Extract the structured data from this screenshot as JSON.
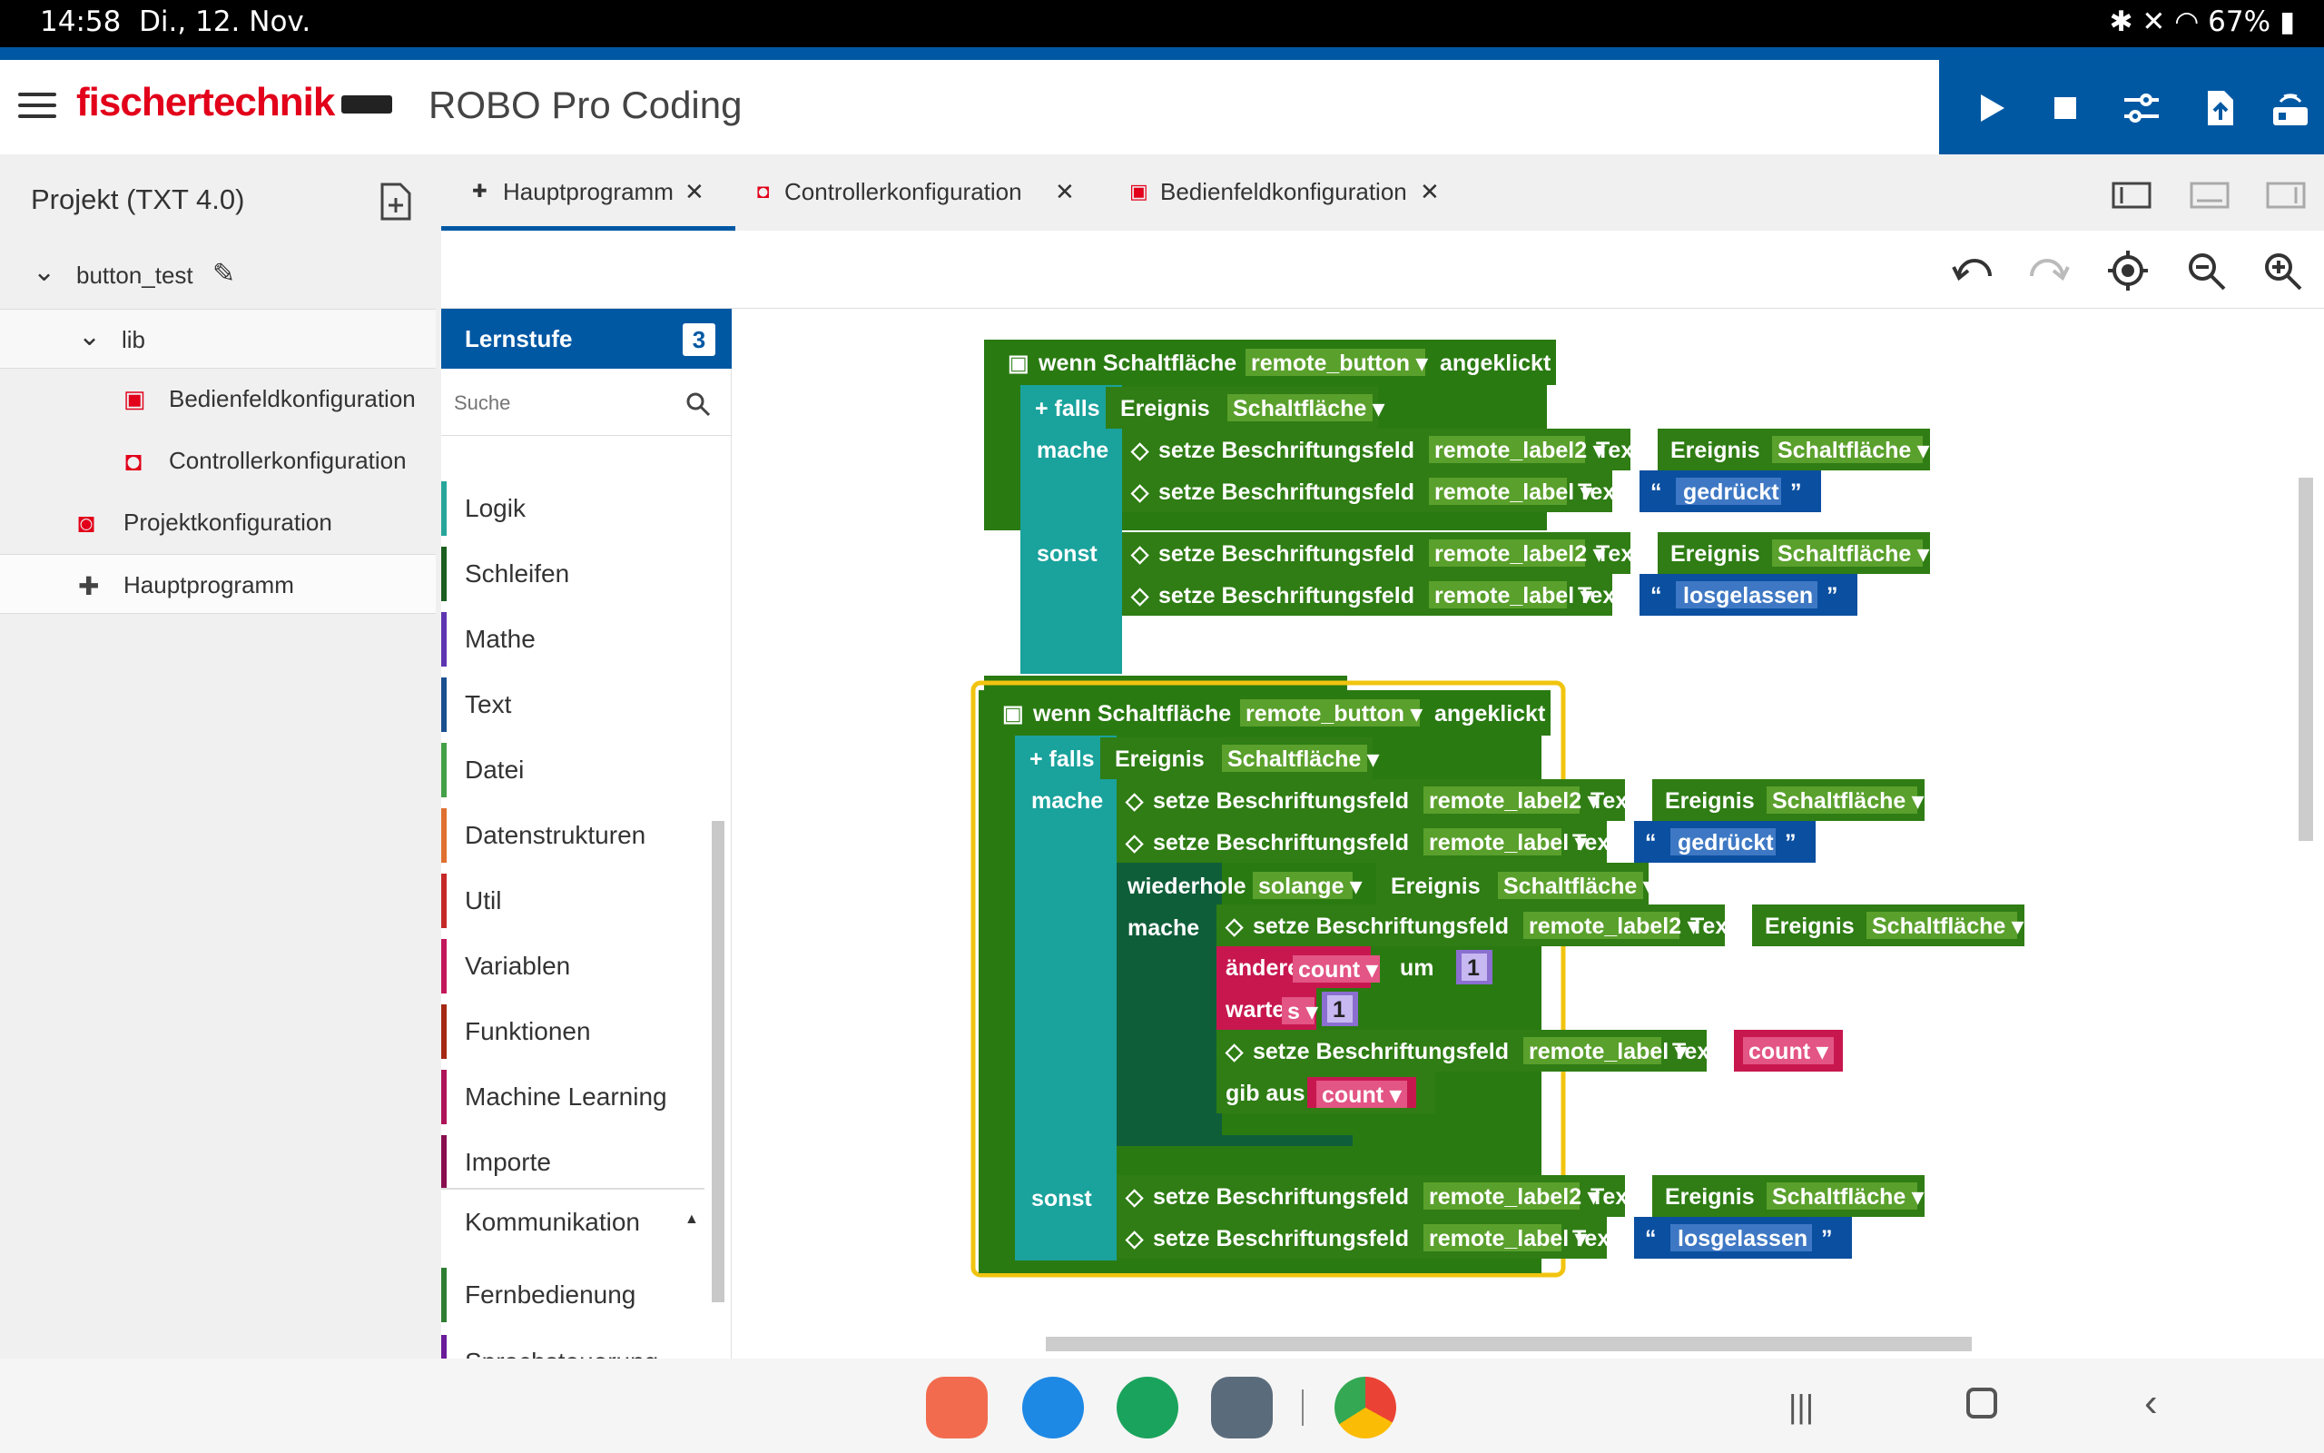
{
  "statusbar": {
    "time": "14:58",
    "date": "Di., 12. Nov.",
    "battery": "67%"
  },
  "header": {
    "logo_a": "fischer",
    "logo_b": "technik",
    "title": "ROBO Pro Coding"
  },
  "toolbar": {
    "icons": [
      "play-icon",
      "stop-icon",
      "settings-sliders-icon",
      "upload-icon",
      "controller-icon"
    ]
  },
  "sidebar": {
    "project_title": "Projekt (TXT 4.0)",
    "tree": [
      {
        "label": "button_test",
        "icon": "chevron-down-icon"
      },
      {
        "label": "lib",
        "icon": "chevron-down-icon"
      },
      {
        "label": "Bedienfeldkonfiguration",
        "icon": "remote-icon"
      },
      {
        "label": "Controllerkonfiguration",
        "icon": "controller-config-icon"
      },
      {
        "label": "Projektkonfiguration",
        "icon": "project-config-icon"
      },
      {
        "label": "Hauptprogramm",
        "icon": "puzzle-icon"
      }
    ]
  },
  "tabs": [
    {
      "label": "Hauptprogramm",
      "active": true
    },
    {
      "label": "Controllerkonfiguration",
      "active": false
    },
    {
      "label": "Bedienfeldkonfiguration",
      "active": false
    }
  ],
  "palette": {
    "lernstufe_label": "Lernstufe",
    "lernstufe_value": "3",
    "search_placeholder": "Suche",
    "categories": [
      {
        "label": "Logik",
        "color": "#26a69a"
      },
      {
        "label": "Schleifen",
        "color": "#1b5e20"
      },
      {
        "label": "Mathe",
        "color": "#5e35b1"
      },
      {
        "label": "Text",
        "color": "#1a4f8f"
      },
      {
        "label": "Datei",
        "color": "#43a047"
      },
      {
        "label": "Datenstrukturen",
        "color": "#e07030"
      },
      {
        "label": "Util",
        "color": "#c62828"
      },
      {
        "label": "Variablen",
        "color": "#c2185b"
      },
      {
        "label": "Funktionen",
        "color": "#a52714"
      },
      {
        "label": "Machine Learning",
        "color": "#ad1457"
      },
      {
        "label": "Importe",
        "color": "#880e4f"
      }
    ],
    "section": "Kommunikation",
    "sub_categories": [
      {
        "label": "Fernbedienung",
        "color": "#2e7d32"
      },
      {
        "label": "Sprachsteuerung",
        "color": "#6a1b9a"
      }
    ]
  },
  "blocks": {
    "wenn": "wenn Schaltfläche",
    "remote_button": "remote_button",
    "angeklickt": "angeklickt",
    "falls": "falls",
    "mache": "mache",
    "sonst": "sonst",
    "ereignis": "Ereignis",
    "schaltflaeche": "Schaltfläche",
    "setze": "setze Beschriftungsfeld",
    "remote_label2": "remote_label2",
    "remote_label": "remote_label",
    "text": "Text",
    "gedrueckt": "gedrückt",
    "losgelassen": "losgelassen",
    "wiederhole": "wiederhole",
    "solange": "solange",
    "aendere": "ändere",
    "count": "count",
    "um": "um",
    "one": "1",
    "warte": "warte",
    "s": "s",
    "gibaus": "gib aus",
    "quote_open": "“",
    "quote_close": "”"
  }
}
